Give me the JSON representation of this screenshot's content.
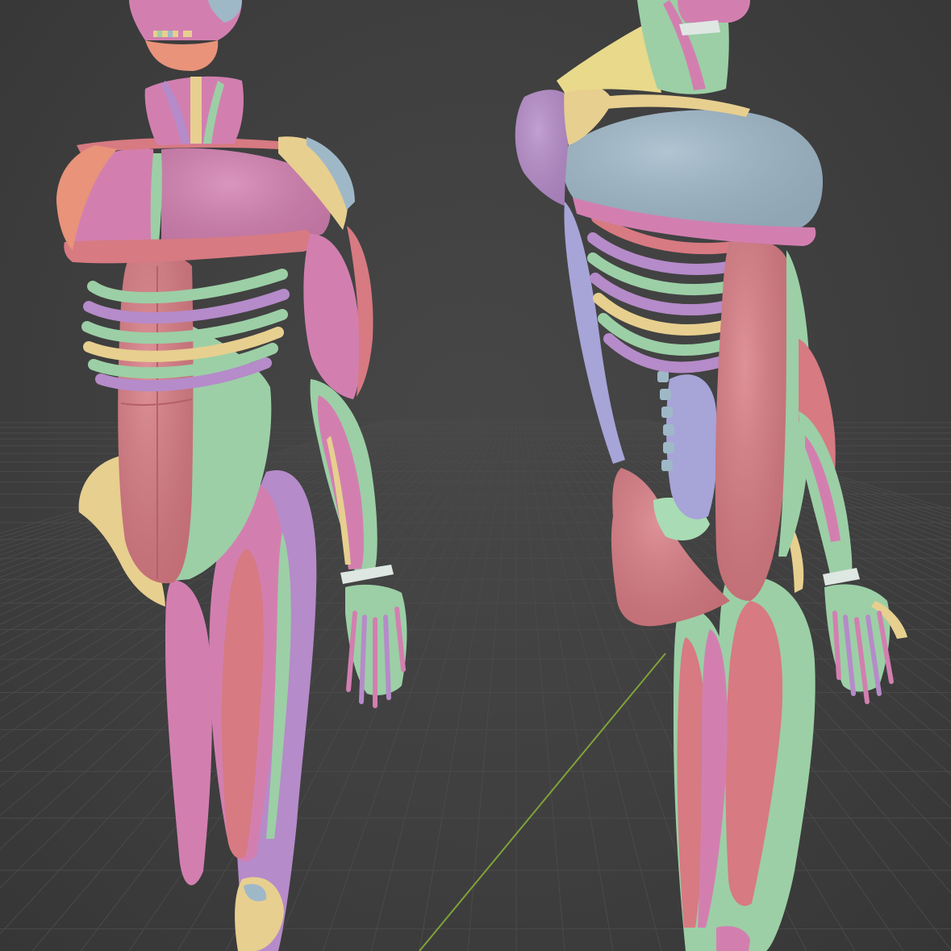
{
  "scene": {
    "background_color": "#3d3d3d",
    "grid_color": "#4a4a4a",
    "y_axis_color": "#7fa33a"
  },
  "palette": {
    "muscle_pink": "#d27fb0",
    "muscle_red": "#d77a82",
    "muscle_purple": "#b58bc9",
    "muscle_green": "#9ccfa6",
    "muscle_blue": "#9fb8c8",
    "bone_yellow": "#e7cf8f",
    "tendon_yellow": "#e8d98b",
    "salmon": "#e8937a",
    "lavender": "#a7a4d8",
    "mint": "#a9dcb4"
  }
}
